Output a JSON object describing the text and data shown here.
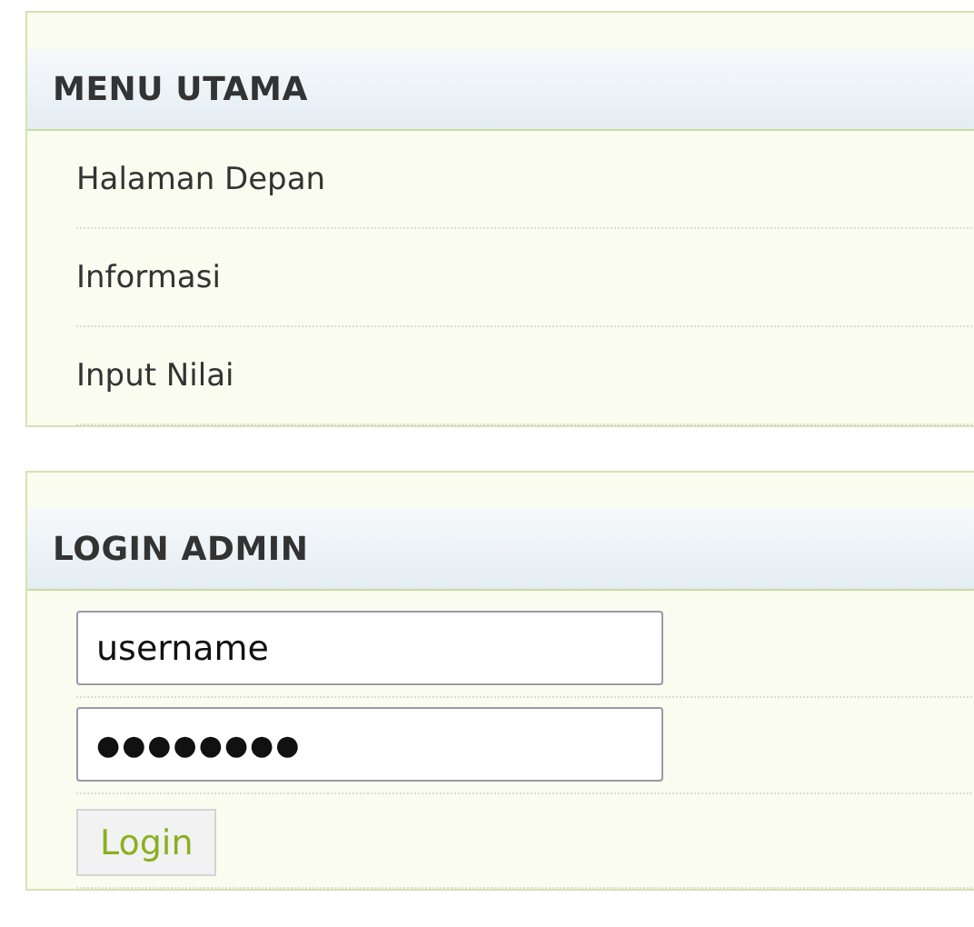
{
  "menu": {
    "title": "MENU UTAMA",
    "items": [
      {
        "label": "Halaman Depan"
      },
      {
        "label": "Informasi"
      },
      {
        "label": "Input Nilai"
      }
    ]
  },
  "login": {
    "title": "LOGIN ADMIN",
    "username": {
      "value": "username"
    },
    "password": {
      "value": "●●●●●●●●"
    },
    "button": "Login"
  }
}
